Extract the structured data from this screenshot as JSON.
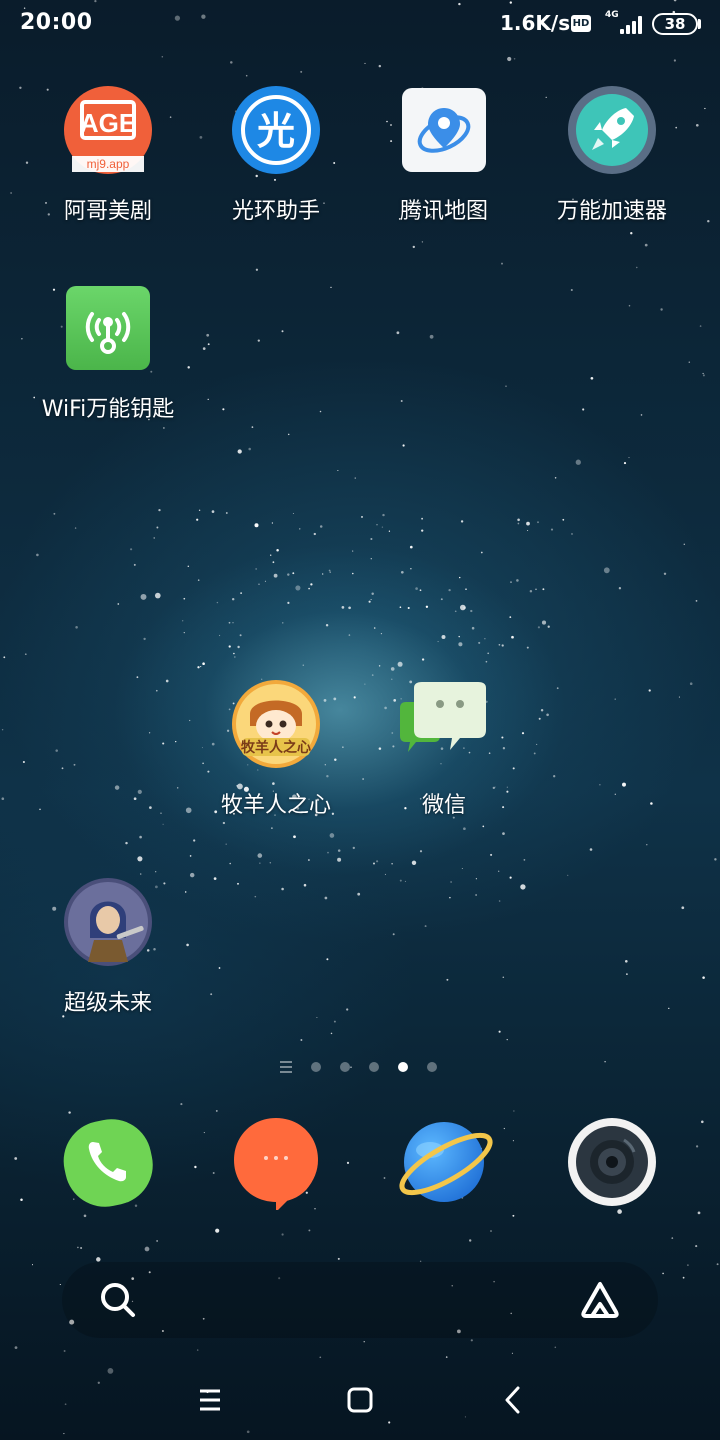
{
  "status_bar": {
    "time": "20:00",
    "net_speed": "1.6K/s",
    "hd_badge": "HD",
    "network_type": "4G",
    "battery": "38",
    "battery_level_percent": 38
  },
  "apps": [
    {
      "label": "阿哥美剧",
      "icon": "age-tv-icon",
      "icon_text": "AGE",
      "icon_subtext": "mj9.app",
      "color": "#f0603a"
    },
    {
      "label": "光环助手",
      "icon": "guanghuan-icon",
      "icon_text": "光",
      "color": "#1e88e5"
    },
    {
      "label": "腾讯地图",
      "icon": "tencent-map-icon",
      "color": "#3b8ee8"
    },
    {
      "label": "万能加速器",
      "icon": "rocket-icon",
      "color": "#3ec5b8"
    },
    {
      "label": "WiFi万能钥匙",
      "icon": "wifi-key-icon",
      "color": "#5ec85a"
    },
    {
      "label": "牧羊人之心",
      "icon": "shepherd-heart-icon",
      "icon_text": "牧羊人之心",
      "color": "#f2a93b"
    },
    {
      "label": "微信",
      "icon": "wechat-icon",
      "color": "#6dc24f"
    },
    {
      "label": "超级未来",
      "icon": "super-future-icon",
      "color": "#4a4f7a"
    }
  ],
  "page_indicator": {
    "pages": 5,
    "active_page": 4
  },
  "dock": [
    {
      "name": "phone",
      "icon": "phone-icon",
      "color": "#6fd454"
    },
    {
      "name": "messages",
      "icon": "message-icon",
      "color": "#ff6a3c"
    },
    {
      "name": "browser",
      "icon": "browser-icon",
      "color": "#2f8df0"
    },
    {
      "name": "camera",
      "icon": "camera-icon",
      "color": "#2b3640"
    }
  ],
  "search_bar": {
    "left_icon": "search-icon",
    "right_icon": "assistant-icon"
  },
  "nav_bar": {
    "buttons": [
      "menu-icon",
      "home-icon",
      "back-icon"
    ]
  }
}
